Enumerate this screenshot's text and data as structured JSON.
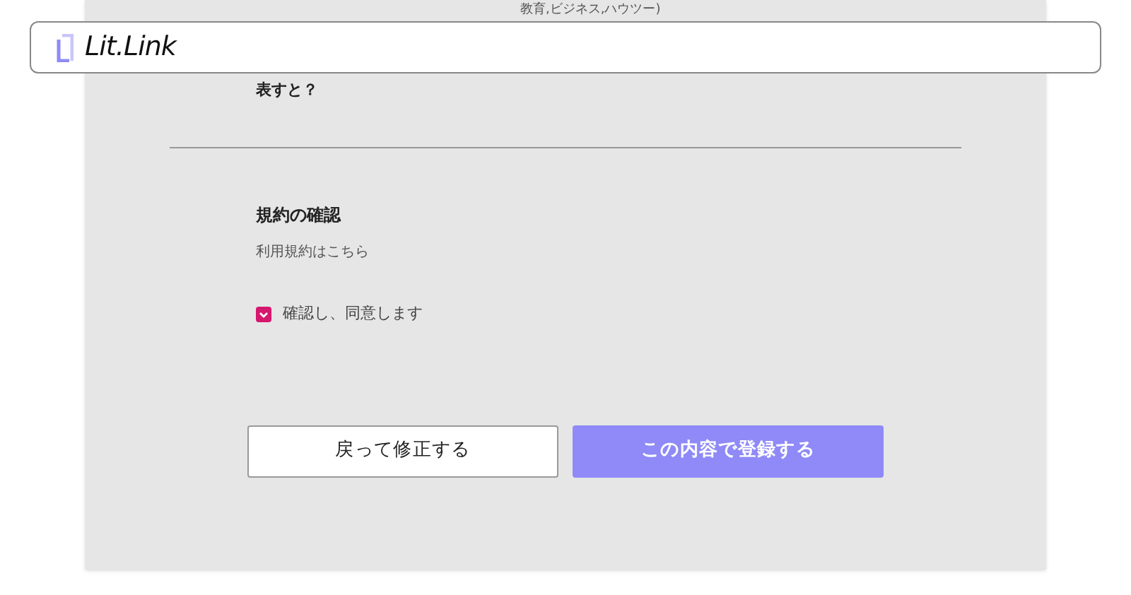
{
  "header": {
    "logo": "Lit.Link"
  },
  "form": {
    "answer_tail": "教育,ビジネス,ハウツー)",
    "question_tail": "表すと？"
  },
  "terms": {
    "title": "規約の確認",
    "link": "利用規約はこちら",
    "agree": {
      "label": "確認し、同意します",
      "checked": true
    }
  },
  "buttons": [
    {
      "label": "戻って修正する",
      "kind": "secondary"
    },
    {
      "label": "この内容で登録する",
      "kind": "primary"
    }
  ]
}
